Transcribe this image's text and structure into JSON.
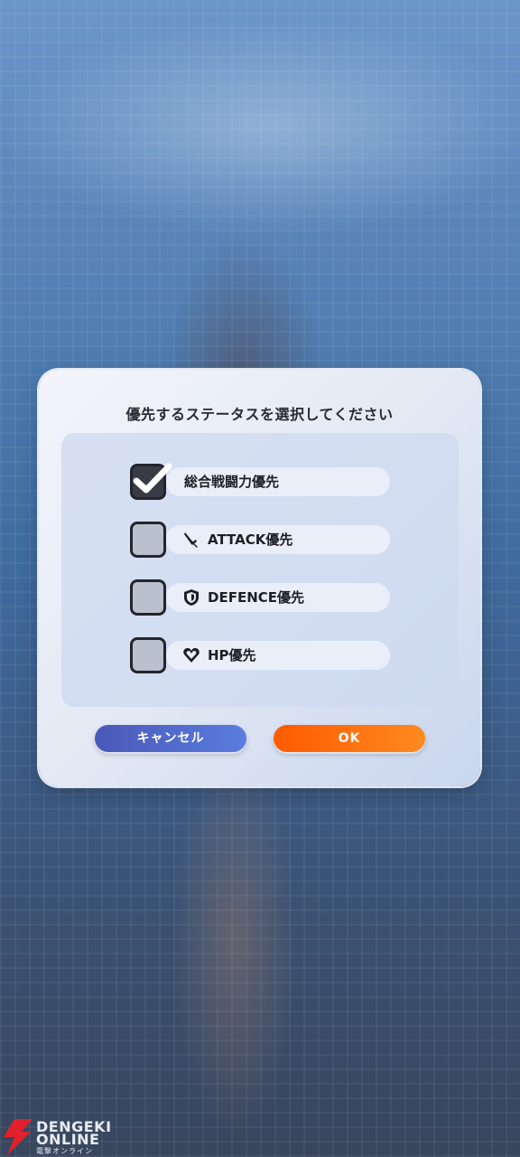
{
  "dialog": {
    "title": "優先するステータスを選択してください",
    "options": [
      {
        "label": "総合戦闘力優先",
        "checked": true,
        "icon": null
      },
      {
        "label": "ATTACK優先",
        "checked": false,
        "icon": "sword-icon"
      },
      {
        "label": "DEFENCE優先",
        "checked": false,
        "icon": "shield-icon"
      },
      {
        "label": "HP優先",
        "checked": false,
        "icon": "heart-icon"
      }
    ],
    "cancel_label": "キャンセル",
    "ok_label": "OK"
  },
  "watermark": {
    "line1": "DENGEKI",
    "line2": "ONLINE",
    "line3": "電撃オンライン"
  },
  "colors": {
    "cancel_button": "#4a58b8",
    "ok_button": "#ff6a00",
    "checkbox_checked": "#3a3a45",
    "checkbox_unchecked": "#b9c0ce"
  }
}
